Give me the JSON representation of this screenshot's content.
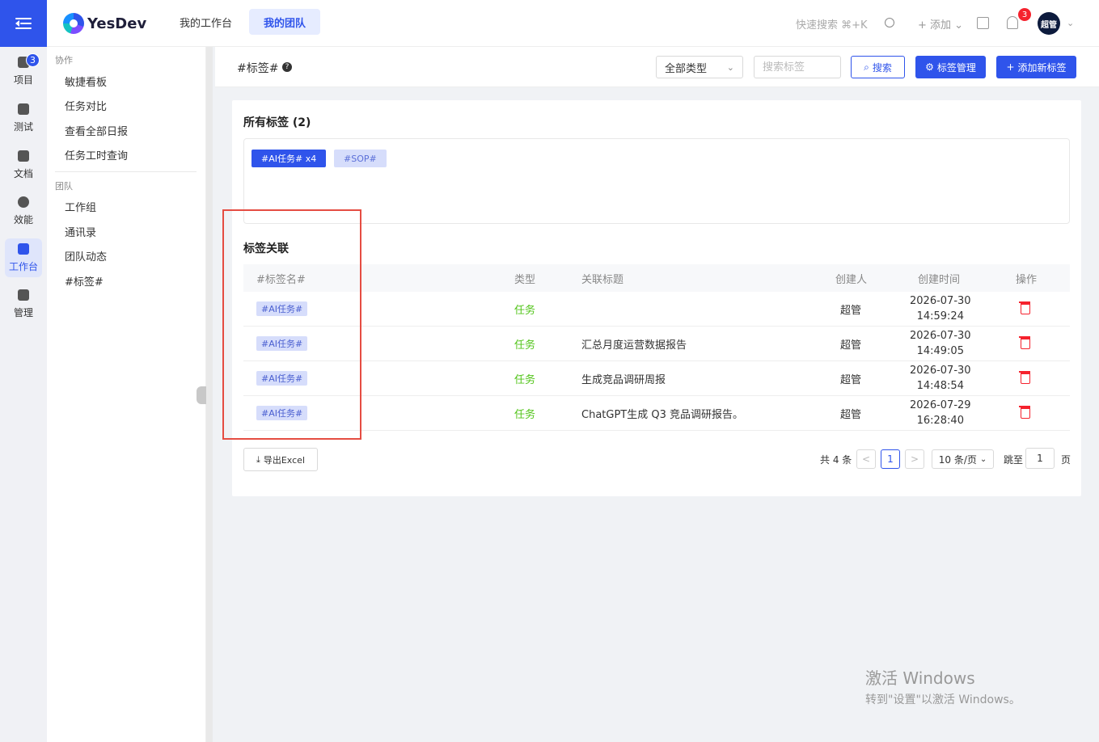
{
  "header": {
    "logo_text": "YesDev",
    "tabs": [
      {
        "label": "我的工作台"
      },
      {
        "label": "我的团队"
      }
    ],
    "search_hint": "快速搜索 ⌘+K",
    "add_label": "+ 添加",
    "notification_count": "3",
    "avatar_text": "超管"
  },
  "rail": {
    "items": [
      {
        "label": "项目",
        "badge": "3"
      },
      {
        "label": "测试"
      },
      {
        "label": "文档"
      },
      {
        "label": "效能"
      },
      {
        "label": "工作台"
      },
      {
        "label": "管理"
      }
    ]
  },
  "side": {
    "group1": "协作",
    "group1_items": [
      "敏捷看板",
      "任务对比",
      "查看全部日报",
      "任务工时查询"
    ],
    "group2": "团队",
    "group2_items": [
      "工作组",
      "通讯录",
      "团队动态",
      "#标签#"
    ]
  },
  "pagebar": {
    "title": "#标签#",
    "help": "?",
    "type_select": "全部类型",
    "search_placeholder": "搜索标签",
    "search_button": "搜索",
    "manage_button": "标签管理",
    "add_button": "添加新标签"
  },
  "all_tags": {
    "title": "所有标签 (2)",
    "tags": [
      "#AI任务# x4",
      "#SOP#"
    ]
  },
  "relations": {
    "title": "标签关联",
    "columns": [
      "#标签名#",
      "类型",
      "关联标题",
      "创建人",
      "创建时间",
      "操作"
    ],
    "rows": [
      {
        "tag": "#AI任务#",
        "type": "任务",
        "title": "",
        "creator": "超管",
        "date": "2026-07-30",
        "time": "14:59:24"
      },
      {
        "tag": "#AI任务#",
        "type": "任务",
        "title": "汇总月度运营数据报告",
        "creator": "超管",
        "date": "2026-07-30",
        "time": "14:49:05"
      },
      {
        "tag": "#AI任务#",
        "type": "任务",
        "title": "生成竞品调研周报",
        "creator": "超管",
        "date": "2026-07-30",
        "time": "14:48:54"
      },
      {
        "tag": "#AI任务#",
        "type": "任务",
        "title": "ChatGPT生成 Q3 竞品调研报告。",
        "creator": "超管",
        "date": "2026-07-29",
        "time": "16:28:40"
      }
    ]
  },
  "footer": {
    "export_button": "导出Excel",
    "total": "共 4 条",
    "prev": "<",
    "current_page": "1",
    "next": ">",
    "page_size": "10 条/页",
    "jump_label": "跳至",
    "jump_value": "1",
    "page_label": "页"
  },
  "os_watermark": {
    "line1": "激活 Windows",
    "line2": "转到\"设置\"以激活 Windows。"
  }
}
